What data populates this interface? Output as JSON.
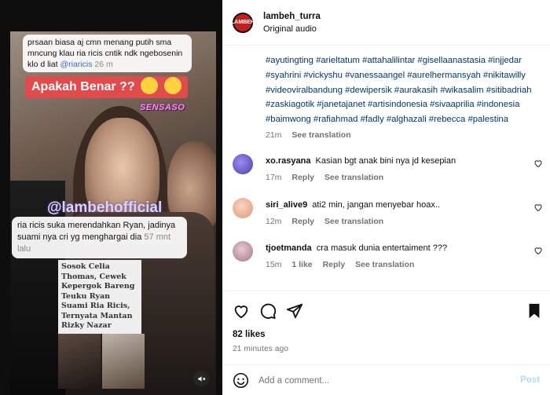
{
  "media": {
    "caption_top": {
      "line": "prsaan biasa aj cmn menang putih sma mncung klau ria ricis cntik ndk ngebosenin klo d liat",
      "mention": "@riaricis",
      "ago": "26 m"
    },
    "banner": "Apakah Benar ??",
    "sticker": "SENSASO",
    "watermark": "@lambehofficial",
    "caption_bottom": {
      "line": "ria ricis suka merendahkan Ryan, jadinya suami nya cri yg menghargai dia",
      "ago": "57 mnt lalu"
    },
    "news_text": "Sosok Celia Thomas, Cewek Kepergok Bareng Teuku Ryan Suami Ria Ricis, Ternyata Mantan Rizky Nazar",
    "mute_icon": "speaker-muted-icon"
  },
  "header": {
    "username": "lambeh_turra",
    "audio": "Original audio",
    "logo_text": "LAMBEH"
  },
  "caption": {
    "hashtags": "#ayutingting #arieltatum #attahalilintar #gisellaanastasia #injjedar #syahrini #vickyshu #vanessaangel #aurelhermansyah #nikitawilly #videoviralbandung #dewipersik #aurakasih #wikasalim #sitibadriah #zaskiagotik #janetajanet #artisindonesia #sivaaprilia #indonesia #baimwong #rafiahmad #fadly #alghazali #rebecca #palestina",
    "time": "21m",
    "translation": "See translation"
  },
  "comments": [
    {
      "user": "xo.rasyana",
      "text": "Kasian bgt anak bini nya jd kesepian",
      "time": "17m",
      "likes": "",
      "reply": "Reply",
      "translation": "See translation",
      "avatar_color": "#4b3fa6"
    },
    {
      "user": "siri_alive9",
      "text": "ati2 min, jangan menyebar hoax..",
      "time": "12m",
      "likes": "",
      "reply": "Reply",
      "translation": "See translation",
      "avatar_color": "#e8a98c"
    },
    {
      "user": "tjoetmanda",
      "text": "cra masuk dunia entertaiment ???",
      "time": "15m",
      "likes": "1 like",
      "reply": "Reply",
      "translation": "See translation",
      "avatar_color": "#b98f9c"
    }
  ],
  "likes": "82 likes",
  "posted": "21 minutes ago",
  "add_comment": {
    "placeholder": "Add a comment...",
    "post": "Post"
  },
  "colors": {
    "link": "#00376b",
    "muted": "#737373",
    "post_disabled": "#b3dbff"
  }
}
